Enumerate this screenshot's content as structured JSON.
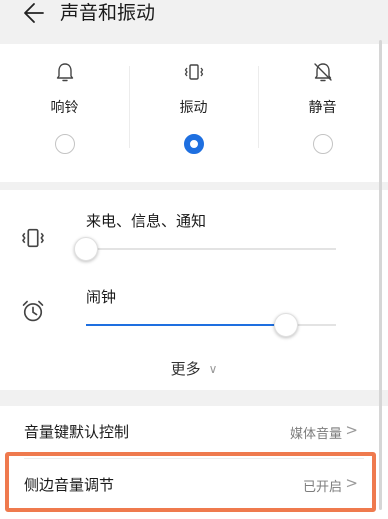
{
  "header": {
    "title": "声音和振动",
    "back_icon": "arrow-left-icon"
  },
  "modes": [
    {
      "label": "响铃",
      "icon": "bell-icon",
      "selected": false
    },
    {
      "label": "振动",
      "icon": "vibrate-icon",
      "selected": true
    },
    {
      "label": "静音",
      "icon": "bell-off-icon",
      "selected": false
    }
  ],
  "volume": {
    "call_label": "来电、信息、通知",
    "call_level": 0.0,
    "alarm_label": "闹钟",
    "alarm_level": 0.8,
    "more_label": "更多"
  },
  "settings": [
    {
      "label": "音量键默认控制",
      "value": "媒体音量"
    },
    {
      "label": "侧边音量调节",
      "value": "已开启"
    }
  ],
  "colors": {
    "accent": "#1e6fe0",
    "highlight": "#ef7a4e"
  }
}
